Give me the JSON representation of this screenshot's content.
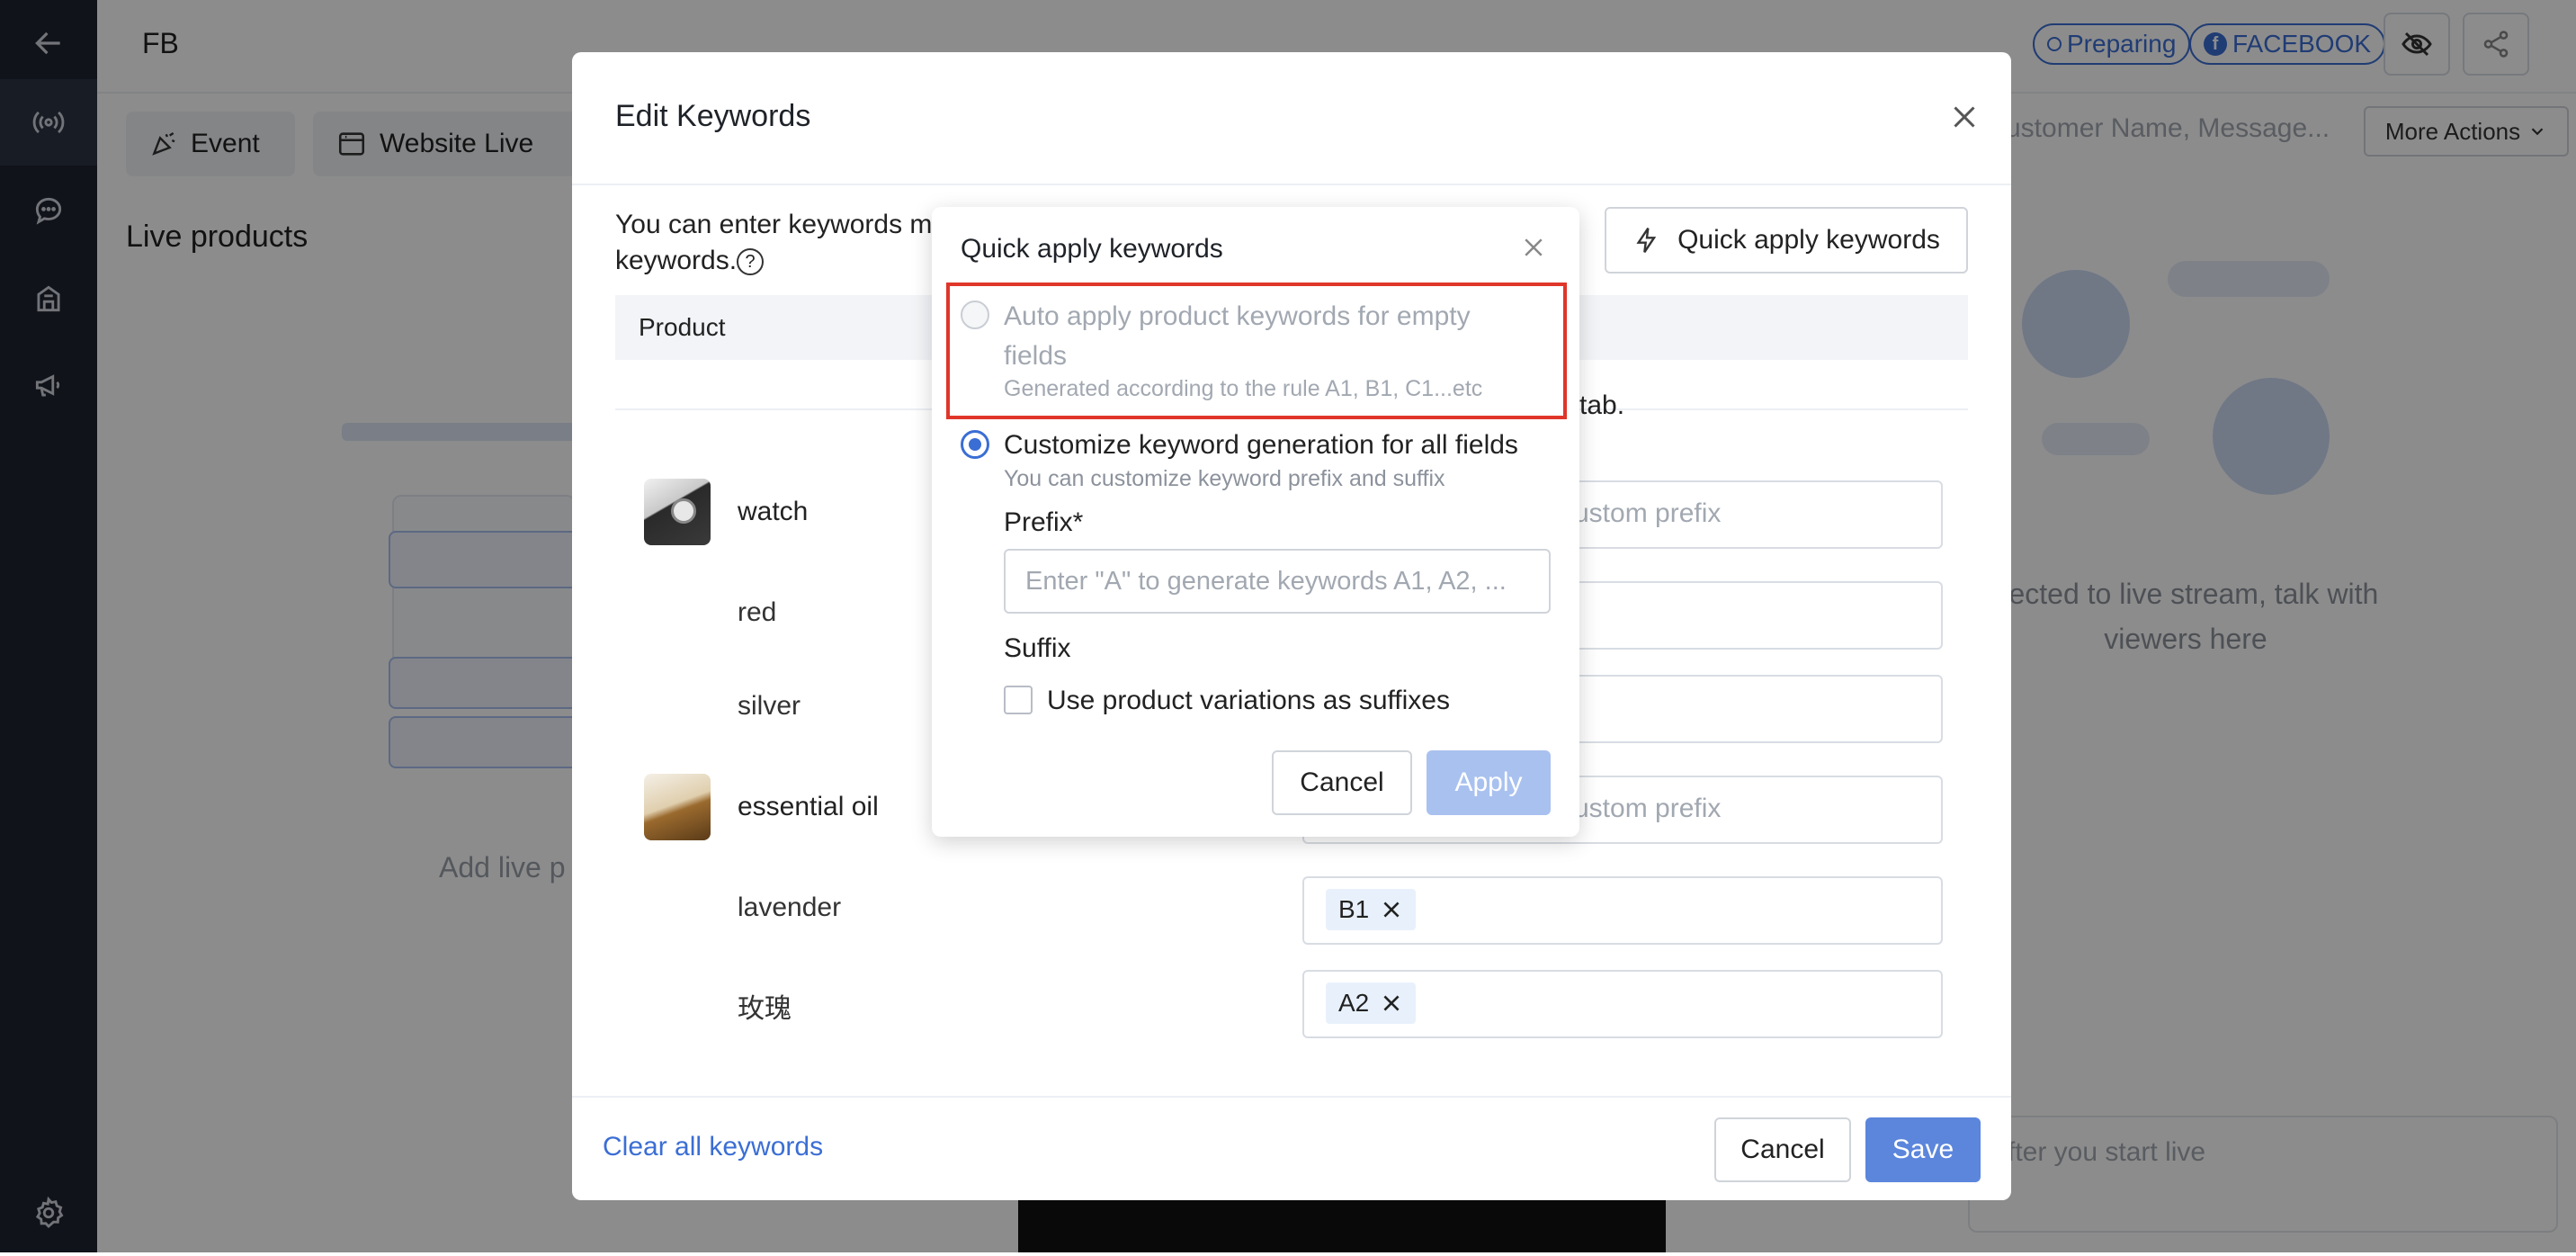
{
  "app": {
    "title": "FB",
    "status_badge": "Preparing",
    "platform_badge": "FACEBOOK",
    "tabs": [
      "Event",
      "Website Live"
    ],
    "left_panel_title": "Live products",
    "left_empty_text": "Add live p",
    "search_placeholder": "ustomer Name, Message...",
    "more_actions": "More Actions",
    "right_message": "nected to live stream, talk with viewers here",
    "right_input_placeholder": "fter you start live"
  },
  "modal": {
    "title": "Edit Keywords",
    "description": "You can enter keywords m",
    "description_line2": "keywords.",
    "quick_apply_button": "Quick apply keywords",
    "table_header": "Product",
    "tab_hint_suffix": "tab.",
    "custom_prefix_placeholder": "ustom prefix",
    "products": [
      {
        "name": "watch",
        "variants": [
          {
            "name": "red",
            "keyword": ""
          },
          {
            "name": "silver",
            "keyword": ""
          }
        ]
      },
      {
        "name": "essential oil",
        "variants": [
          {
            "name": "lavender",
            "keyword": "B1"
          },
          {
            "name": "玫瑰",
            "keyword": "A2"
          }
        ]
      }
    ],
    "clear_all": "Clear all keywords",
    "cancel": "Cancel",
    "save": "Save"
  },
  "popover": {
    "title": "Quick apply keywords",
    "option_auto": {
      "title": "Auto apply product keywords for empty fields",
      "subtitle": "Generated according to the rule A1, B1, C1...etc",
      "selected": false,
      "disabled": true
    },
    "option_custom": {
      "title": "Customize keyword generation for all fields",
      "subtitle": "You can customize keyword prefix and suffix",
      "selected": true
    },
    "prefix_label": "Prefix*",
    "prefix_placeholder": "Enter \"A\" to generate keywords A1, A2, ...",
    "suffix_label": "Suffix",
    "suffix_checkbox_label": "Use product variations as suffixes",
    "suffix_checked": false,
    "cancel": "Cancel",
    "apply": "Apply"
  },
  "colors": {
    "accent": "#3b6ed4",
    "primary_button": "#5b86dc",
    "disabled_button": "#a9c1ef",
    "highlight_border": "#e0362a",
    "rail": "#1f2430"
  }
}
